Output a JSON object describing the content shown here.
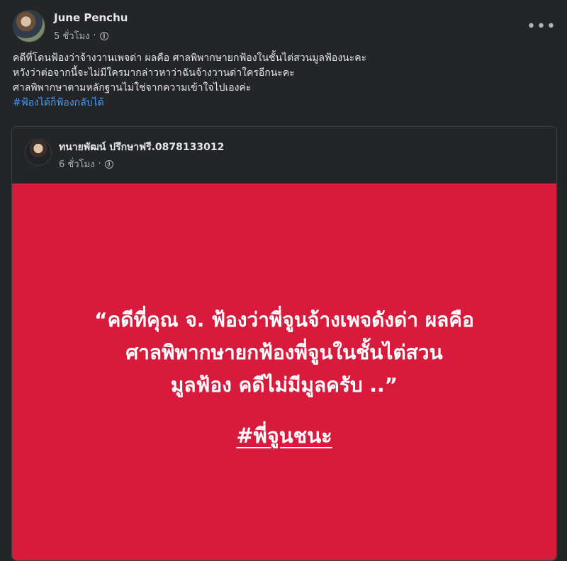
{
  "post": {
    "author": "June Penchu",
    "time": "5 ชั่วโมง",
    "privacy_icon": "globe-icon",
    "more_icon": "more-horizontal-icon",
    "more_label": "•••",
    "body_lines": [
      "คดีที่โดนฟ้องว่าจ้างวานเพจด่า ผลคือ ศาลพิพากษายกฟ้องในชั้นไต่สวนมูลฟ้องนะคะ",
      "หวังว่าต่อจากนี้จะไม่มีใครมากล่าวหาว่าฉันจ้างวานด่าใครอีกนะคะ",
      "ศาลพิพากษาตามหลักฐานไม่ใช่จากความเข้าใจไปเองค่ะ"
    ],
    "hashtag": "#ฟ้องได้ก็ฟ้องกลับได้"
  },
  "shared_post": {
    "author": "ทนายพัฒน์ ปรึกษาฟรี.0878133012",
    "time": "6 ชั่วโมง",
    "privacy_icon": "globe-icon",
    "background_color": "#d81b3c",
    "quote_lines": [
      "“คดีที่คุณ จ. ฟ้องว่าพี่จูนจ้างเพจดังด่า ผลคือ",
      "ศาลพิพากษายกฟ้องพี่จูนในชั้นไต่สวน",
      "มูลฟ้อง คดีไม่มีมูลครับ ..”"
    ],
    "hashtag": "#พี่จูนชนะ"
  }
}
